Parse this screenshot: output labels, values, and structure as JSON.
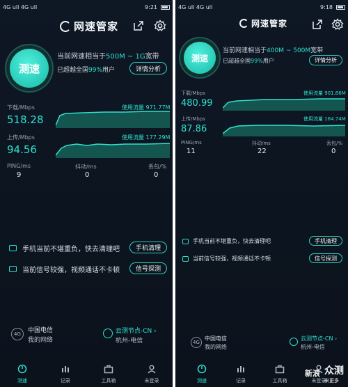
{
  "watermark": {
    "logo": "新浪",
    "title": "众测",
    "sub": "来更多"
  },
  "left": {
    "status": {
      "signal": "4G ull 4G ull",
      "time": "9:21"
    },
    "brand": "网速管家",
    "speed_button": "测速",
    "info_prefix": "当前网速相当于",
    "info_speed": "500M ~ 1G",
    "info_suffix": "宽带",
    "beat_prefix": "已超越全国",
    "beat_pct": "99%",
    "beat_suffix": "用户",
    "detail_button": "详情分析",
    "download_label": "下载/Mbps",
    "download_value": "518.28",
    "download_chart_label": "使用流量 971.77M",
    "upload_label": "上传/Mbps",
    "upload_value": "94.56",
    "upload_chart_label": "使用流量 177.29M",
    "ping_label": "PING/ms",
    "ping_value": "9",
    "jitter_label": "抖动/ms",
    "jitter_value": "0",
    "loss_label": "丢包/%",
    "loss_value": "0",
    "tip1_text": "手机当前不堪重负，快去清理吧",
    "tip1_button": "手机清理",
    "tip2_text": "当前信号较强，视频通话不卡顿",
    "tip2_button": "信号探测",
    "net_badge": "4G",
    "carrier": "中国电信",
    "my_network": "我的网络",
    "node_name": "云测节点-CN",
    "node_city": "杭州-电信",
    "tabs": [
      "测速",
      "记录",
      "工具箱",
      "未登录"
    ]
  },
  "right": {
    "status": {
      "signal": "4G ull 4G ull",
      "time": "9:18"
    },
    "brand": "网速管家",
    "speed_button": "测速",
    "info_prefix": "当前网速相当于",
    "info_speed": "400M ~ 500M",
    "info_suffix": "宽带",
    "beat_prefix": "已超越全国",
    "beat_pct": "99%",
    "beat_suffix": "用户",
    "detail_button": "详情分析",
    "download_label": "下载/Mbps",
    "download_value": "480.99",
    "download_chart_label": "使用流量 901.86M",
    "upload_label": "上传/Mbps",
    "upload_value": "87.86",
    "upload_chart_label": "使用流量 164.74M",
    "ping_label": "PING/ms",
    "ping_value": "11",
    "jitter_label": "抖动/ms",
    "jitter_value": "22",
    "loss_label": "丢包/%",
    "loss_value": "0",
    "tip1_text": "手机当前不堪重负，快去清理吧",
    "tip1_button": "手机清理",
    "tip2_text": "当前信号较强，视频通话不卡顿",
    "tip2_button": "信号探测",
    "net_badge": "4G",
    "carrier": "中国电信",
    "my_network": "我的网络",
    "node_name": "云测节点-CN",
    "node_city": "杭州-电信",
    "tabs": [
      "测速",
      "记录",
      "工具箱",
      "未登录"
    ]
  }
}
